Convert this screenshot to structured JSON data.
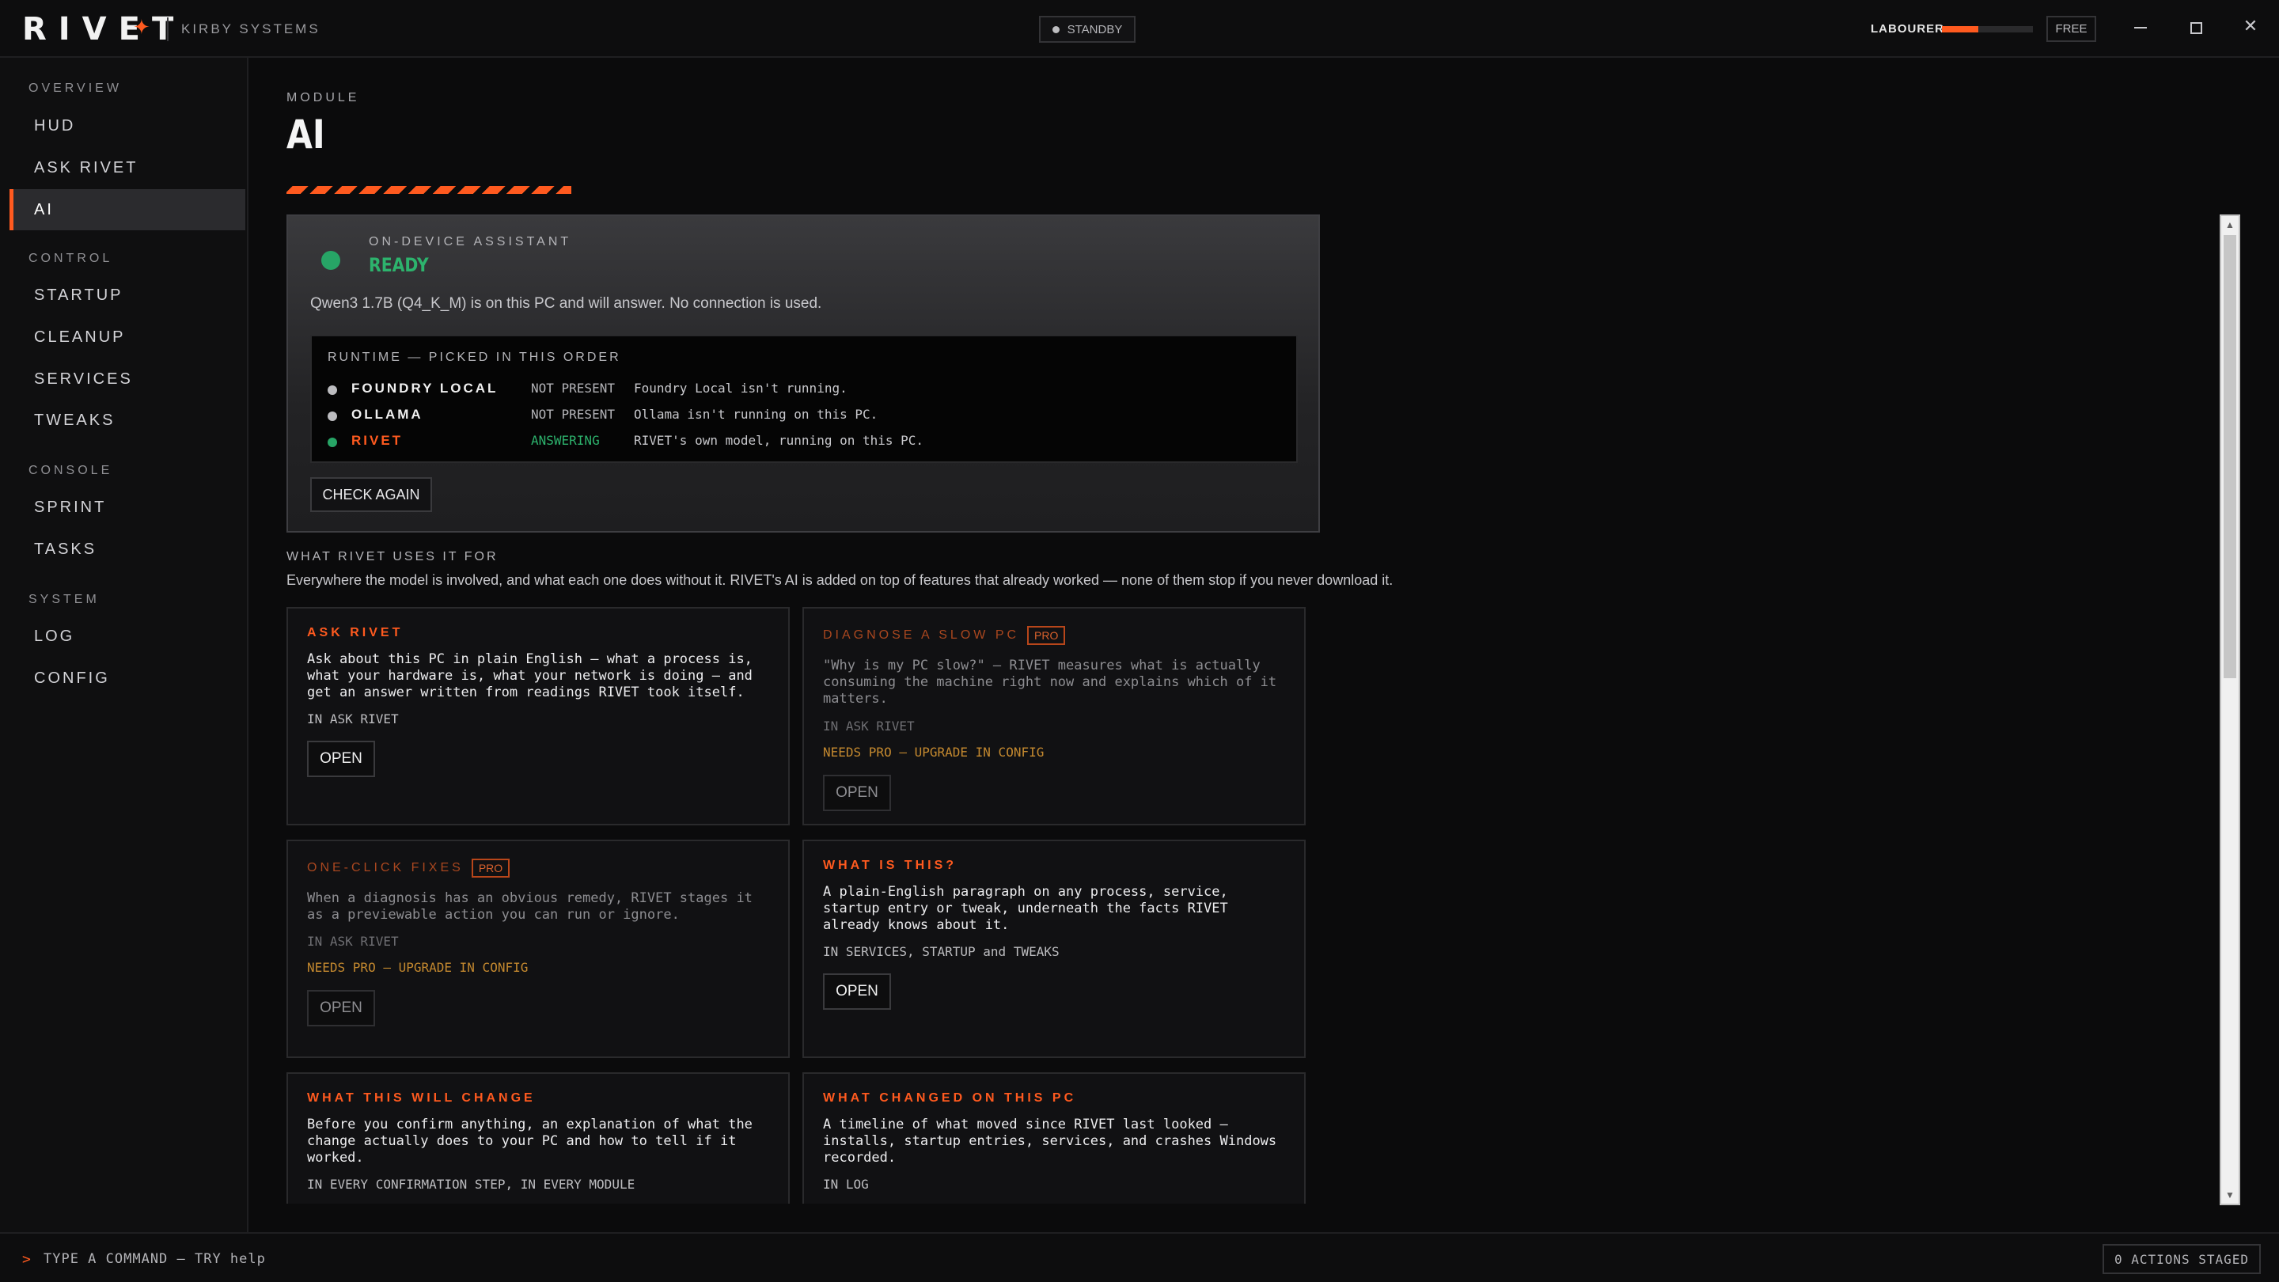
{
  "app": {
    "logo": "RIVET",
    "logo_spark_icon": "spark-icon",
    "company": "KIRBY SYSTEMS",
    "status": "STANDBY",
    "profile": "LABOURER",
    "profile_meter_fraction": 0.4,
    "tier": "FREE"
  },
  "sidebar": {
    "sections": [
      {
        "label": "OVERVIEW",
        "items": [
          {
            "label": "HUD"
          },
          {
            "label": "ASK RIVET"
          },
          {
            "label": "AI",
            "active": true
          }
        ]
      },
      {
        "label": "CONTROL",
        "items": [
          {
            "label": "STARTUP"
          },
          {
            "label": "CLEANUP"
          },
          {
            "label": "SERVICES"
          },
          {
            "label": "TWEAKS"
          }
        ]
      },
      {
        "label": "CONSOLE",
        "items": [
          {
            "label": "SPRINT"
          },
          {
            "label": "TASKS"
          }
        ]
      },
      {
        "label": "SYSTEM",
        "items": [
          {
            "label": "LOG"
          },
          {
            "label": "CONFIG"
          }
        ]
      }
    ]
  },
  "page": {
    "module_label": "MODULE",
    "title": "AI"
  },
  "assistant": {
    "label": "ON-DEVICE ASSISTANT",
    "state": "READY",
    "description": "Qwen3 1.7B (Q4_K_M) is on this PC and will answer. No connection is used.",
    "runtime_title": "RUNTIME — PICKED IN THIS ORDER",
    "runtimes": [
      {
        "name": "FOUNDRY LOCAL",
        "state": "NOT PRESENT",
        "note": "Foundry Local isn't running.",
        "active": false
      },
      {
        "name": "OLLAMA",
        "state": "NOT PRESENT",
        "note": "Ollama isn't running on this PC.",
        "active": false
      },
      {
        "name": "RIVET",
        "state": "ANSWERING",
        "note": "RIVET's own model, running on this PC.",
        "active": true
      }
    ],
    "check_again": "CHECK AGAIN"
  },
  "uses": {
    "label": "WHAT RIVET USES IT FOR",
    "description": "Everywhere the model is involved, and what each one does without it. RIVET's AI is added on top of features that already worked — none of them stop if you never download it.",
    "cards": [
      {
        "title": "ASK RIVET",
        "pro": false,
        "body": "Ask about this PC in plain English — what a process is, what your hardware is, what your network is doing — and get an answer written from readings RIVET took itself.",
        "location": "IN ASK RIVET",
        "needs": "",
        "open": "OPEN"
      },
      {
        "title": "DIAGNOSE A SLOW PC",
        "pro": true,
        "pro_label": "PRO",
        "body": "\"Why is my PC slow?\" — RIVET measures what is actually consuming the machine right now and explains which of it matters.",
        "location": "IN ASK RIVET",
        "needs": "NEEDS PRO — UPGRADE IN CONFIG",
        "open": "OPEN"
      },
      {
        "title": "ONE-CLICK FIXES",
        "pro": true,
        "pro_label": "PRO",
        "body": "When a diagnosis has an obvious remedy, RIVET stages it as a previewable action you can run or ignore.",
        "location": "IN ASK RIVET",
        "needs": "NEEDS PRO — UPGRADE IN CONFIG",
        "open": "OPEN"
      },
      {
        "title": "WHAT IS THIS?",
        "pro": false,
        "body": "A plain-English paragraph on any process, service, startup entry or tweak, underneath the facts RIVET already knows about it.",
        "location": "IN SERVICES, STARTUP and TWEAKS",
        "needs": "",
        "open": "OPEN"
      },
      {
        "title": "WHAT THIS WILL CHANGE",
        "pro": false,
        "body": "Before you confirm anything, an explanation of what the change actually does to your PC and how to tell if it worked.",
        "location": "IN EVERY CONFIRMATION STEP, IN EVERY MODULE",
        "needs": "",
        "open": ""
      },
      {
        "title": "WHAT CHANGED ON THIS PC",
        "pro": false,
        "body": "A timeline of what moved since RIVET last looked — installs, startup entries, services, and crashes Windows recorded.",
        "location": "IN LOG",
        "needs": "",
        "open": ""
      }
    ]
  },
  "statusbar": {
    "prompt": "TYPE A COMMAND — TRY help",
    "actions_staged": "0 ACTIONS STAGED"
  },
  "colors": {
    "accent": "#ff5a1f",
    "ready_green": "#2db36d",
    "needs_pro": "#c4892f",
    "background": "#0b0b0c"
  }
}
